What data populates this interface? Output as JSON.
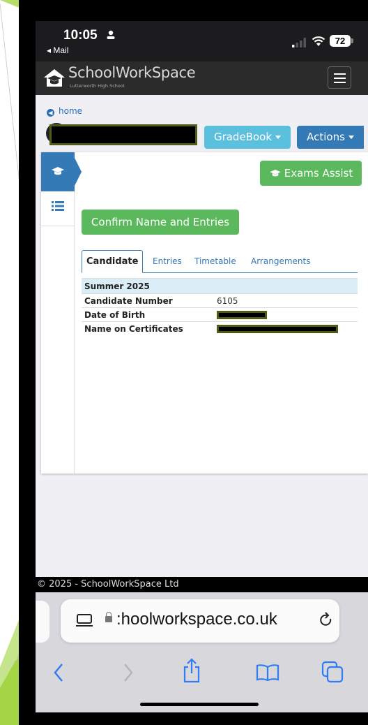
{
  "status_bar": {
    "time": "10:05",
    "back_label": "◂ Mail",
    "battery": "72"
  },
  "navbar": {
    "brand": "SchoolWorkSpace",
    "school": "Lutterworth High School"
  },
  "breadcrumb": {
    "home": "home"
  },
  "buttons": {
    "gradebook": "GradeBook",
    "actions": "Actions",
    "exams_assist": "Exams Assist",
    "confirm": "Confirm Name and Entries"
  },
  "tabs": [
    "Candidate",
    "Entries",
    "Timetable",
    "Arrangements"
  ],
  "candidate": {
    "session": "Summer 2025",
    "rows": [
      {
        "label": "Candidate Number",
        "value": "6105"
      },
      {
        "label": "Date of Birth",
        "value": ""
      },
      {
        "label": "Name on Certificates",
        "value": ""
      }
    ]
  },
  "footer": "© 2025 - SchoolWorkSpace Ltd",
  "safari": {
    "url": ":hoolworkspace.co.uk"
  },
  "colors": {
    "primary": "#337ab7",
    "info": "#5bc0de",
    "success": "#5cb85c",
    "navbar": "#2b2b2b",
    "slide_accent": "#8bc53f"
  }
}
